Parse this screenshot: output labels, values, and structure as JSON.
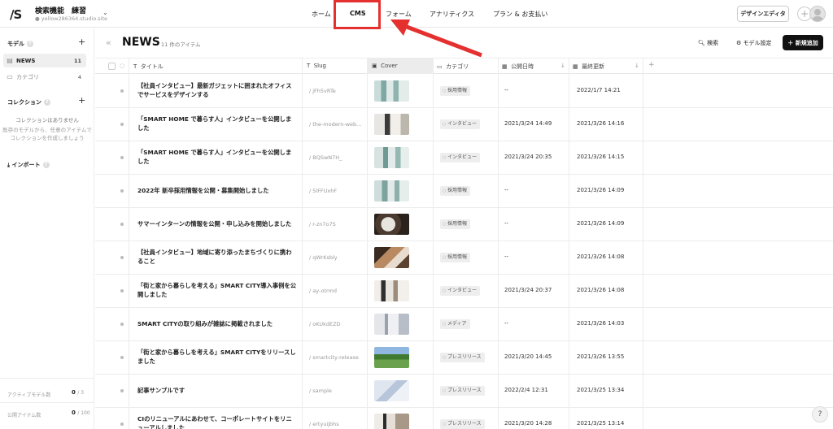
{
  "app": {
    "logo": "/S",
    "project_name": "検索機能　練習",
    "project_url": "yellow286364.studio.site"
  },
  "nav": {
    "home": "ホーム",
    "cms": "CMS",
    "form": "フォーム",
    "analytics": "アナリティクス",
    "plan": "プラン & お支払い"
  },
  "toolbar": {
    "design_editor": "デザインエディタ"
  },
  "sidebar": {
    "models_label": "モデル",
    "items": [
      {
        "label": "NEWS",
        "count": "11"
      },
      {
        "label": "カテゴリ",
        "count": "4"
      }
    ],
    "collections_label": "コレクション",
    "collections_empty_1": "コレクションはありません",
    "collections_empty_2": "既存のモデルから、任意のアイテムで",
    "collections_empty_3": "コレクションを作成しましょう",
    "import_label": "インポート",
    "active_models_label": "アクティブモデル数",
    "active_models_value": "0",
    "active_models_max": "/ 3",
    "public_items_label": "公開アイテム数",
    "public_items_value": "0",
    "public_items_max": "/ 100"
  },
  "main": {
    "title": "NEWS",
    "item_count": "11 件のアイテム",
    "search_label": "検索",
    "model_settings_label": "モデル設定",
    "new_button_label": "＋ 新規追加"
  },
  "columns": {
    "title": "タイトル",
    "slug": "Slug",
    "cover": "Cover",
    "category": "カテゴリ",
    "published": "公開日時",
    "updated": "最終更新"
  },
  "rows": [
    {
      "title": "【社員インタビュー】最新ガジェットに囲まれたオフィスでサービスをデザインする",
      "slug": "/ jFh5vRTe",
      "category": "採用情報",
      "published": "--",
      "updated": "2022/1/7 14:21"
    },
    {
      "title": "「SMART HOME で暮らす人」インタビューを公開しました",
      "slug": "/ the-modern-web...",
      "category": "インタビュー",
      "published": "2021/3/24 14:49",
      "updated": "2021/3/26 14:16"
    },
    {
      "title": "「SMART HOME で暮らす人」インタビューを公開しました",
      "slug": "/ BQSwN7H_",
      "category": "インタビュー",
      "published": "2021/3/24 20:35",
      "updated": "2021/3/26 14:15"
    },
    {
      "title": "2022年 新卒採用情報を公開・募集開始しました",
      "slug": "/ SlFFUxhF",
      "category": "採用情報",
      "published": "--",
      "updated": "2021/3/26 14:09"
    },
    {
      "title": "サマーインターンの情報を公開・申し込みを開始しました",
      "slug": "/ r-zn7o7S",
      "category": "採用情報",
      "published": "--",
      "updated": "2021/3/26 14:09"
    },
    {
      "title": "【社員インタビュー】地域に寄り添ったまちづくりに携わること",
      "slug": "/ qWrKsbly",
      "category": "採用情報",
      "published": "--",
      "updated": "2021/3/26 14:08"
    },
    {
      "title": "「街と家から暮らしを考える」SMART CITY導入事例を公開しました",
      "slug": "/ ay-otrmd",
      "category": "インタビュー",
      "published": "2021/3/24 20:37",
      "updated": "2021/3/26 14:08"
    },
    {
      "title": "SMART CITYの取り組みが雑誌に掲載されました",
      "slug": "/ oKUkdEZD",
      "category": "メディア",
      "published": "--",
      "updated": "2021/3/26 14:03"
    },
    {
      "title": "「街と家から暮らしを考える」SMART CITYをリリースしました",
      "slug": "/ smartcity-release",
      "category": "プレスリリース",
      "published": "2021/3/20 14:45",
      "updated": "2021/3/26 13:55"
    },
    {
      "title": "記事サンプルです",
      "slug": "/ sample",
      "category": "プレスリリース",
      "published": "2022/2/4 12:31",
      "updated": "2021/3/25 13:34"
    },
    {
      "title": "CIのリニューアルにあわせて、コーポレートサイトをリニューアルしました",
      "slug": "/ ertyuijbhs",
      "category": "プレスリリース",
      "published": "2021/3/20 14:28",
      "updated": "2021/3/25 13:14"
    }
  ],
  "help": "?",
  "colors": {
    "accent_red": "#e53030",
    "primary_button": "#111111"
  }
}
